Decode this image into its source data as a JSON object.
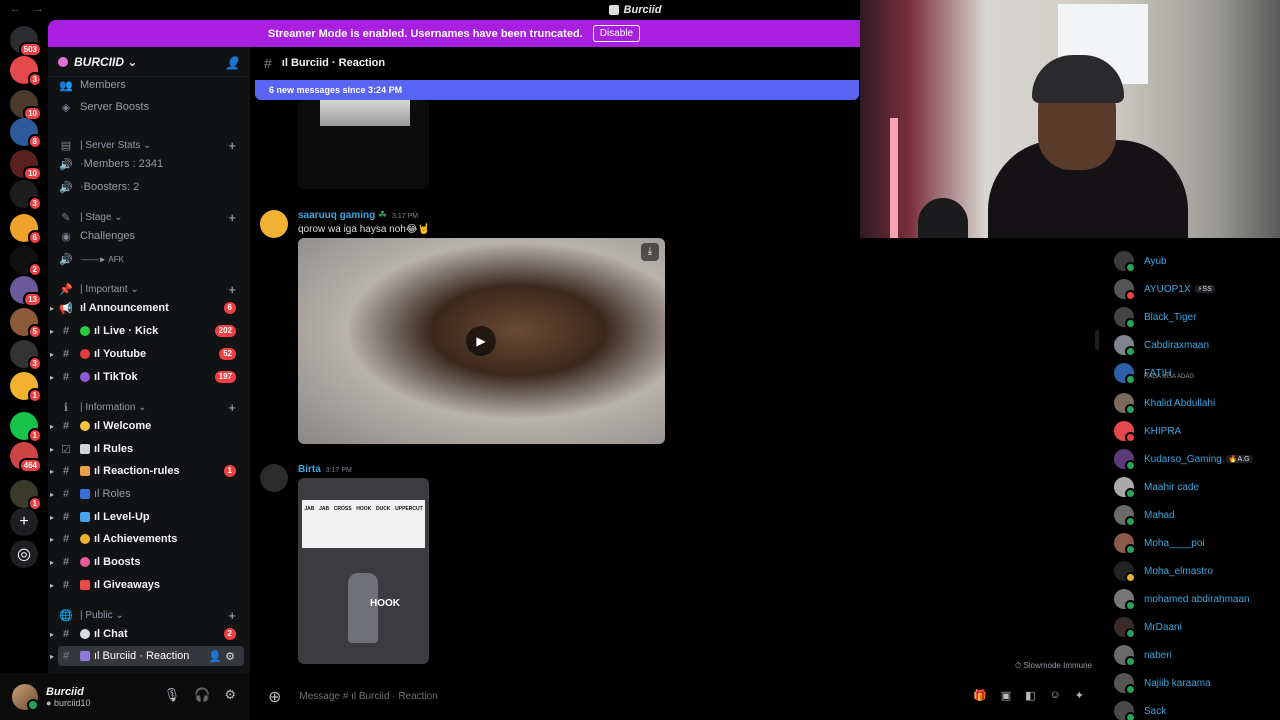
{
  "window": {
    "title": "Burciid"
  },
  "banner": {
    "text": "Streamer Mode is enabled. Usernames have been truncated.",
    "disable_label": "Disable"
  },
  "rail": {
    "badges": [
      "503",
      "3",
      "10",
      "8",
      "10",
      "3",
      "6",
      "2",
      "13",
      "5",
      "3",
      "1",
      "1",
      "464",
      "1"
    ]
  },
  "server": {
    "name": "BURCIID"
  },
  "sidebar": {
    "members_label": "Members",
    "boosts_label": "Server Boosts",
    "cat_stats": "| Server Stats",
    "members_count": "·Members : 2341",
    "boosters_count": "·Boosters: 2",
    "cat_stage": "| Stage",
    "challenges": "Challenges",
    "afk": "·——► AFK",
    "cat_important": "| Important",
    "announcement": "ıl Announcement",
    "announcement_badge": "6",
    "live_kick": "ıl Live · Kick",
    "live_kick_badge": "202",
    "youtube": "ıl Youtube",
    "youtube_badge": "52",
    "tiktok": "ıl TikTok",
    "tiktok_badge": "197",
    "cat_information": "| Information",
    "welcome": "ıl Welcome",
    "rules": "ıl Rules",
    "reaction_rules": "ıl Reaction-rules",
    "reaction_rules_badge": "1",
    "roles": "ıl Roles",
    "level_up": "ıl Level-Up",
    "achievements": "ıl Achievements",
    "boosts": "ıl Boosts",
    "giveaways": "ıl Giveaways",
    "cat_public": "| Public",
    "chat": "ıl Chat",
    "chat_badge": "2",
    "burciid_reaction": "ıl Burciid · Reaction"
  },
  "user": {
    "name": "Burciid",
    "tag": "burciid10"
  },
  "chat": {
    "channel": "ıl Burciid · Reaction",
    "new_messages": "6 new messages since 3:24 PM",
    "msg1_user": "saaruuq gaming",
    "msg1_time": "3:17 PM",
    "msg1_text": "qorow wa iga haysa noh😂🤘",
    "msg2_user": "Birta",
    "msg2_time": "3:17 PM",
    "gif_moves": [
      "JAB",
      "JAB",
      "CROSS",
      "HOOK",
      "DUCK",
      "UPPERCUT"
    ],
    "gif_caption": "HOOK",
    "slowmode": "Slowmode Immune",
    "composer_placeholder": "Message # ıl Burciid · Reaction"
  },
  "members": [
    {
      "name": "Ayub",
      "status": "online"
    },
    {
      "name": "AYUOP1X",
      "tag": "⚡SS",
      "status": "online"
    },
    {
      "name": "Black_Tiger",
      "status": "online"
    },
    {
      "name": "Cabdiraxmaan",
      "status": "online"
    },
    {
      "name": "FATIH",
      "sub": "RAGA KISA ADAG",
      "status": "online"
    },
    {
      "name": "Khalid Abdullahi",
      "status": "online"
    },
    {
      "name": "KHIPRA",
      "status": "dnd"
    },
    {
      "name": "Kudarso_Gaming",
      "tag": "🔥A.G",
      "status": "online"
    },
    {
      "name": "Maahir cade",
      "status": "online"
    },
    {
      "name": "Mahad",
      "status": "online"
    },
    {
      "name": "Moha____poi",
      "status": "online"
    },
    {
      "name": "Moha_elmastro",
      "status": "idle"
    },
    {
      "name": "mohamed abdirahmaan",
      "status": "online"
    },
    {
      "name": "MrDaani",
      "status": "online"
    },
    {
      "name": "naberi",
      "status": "online"
    },
    {
      "name": "Najiib karaama",
      "status": "online"
    },
    {
      "name": "Sack",
      "status": "online"
    }
  ],
  "colors": {
    "accent": "#5865f2",
    "banner": "#a81fe0",
    "username": "#3ba5e0",
    "badge": "#f23f43"
  }
}
